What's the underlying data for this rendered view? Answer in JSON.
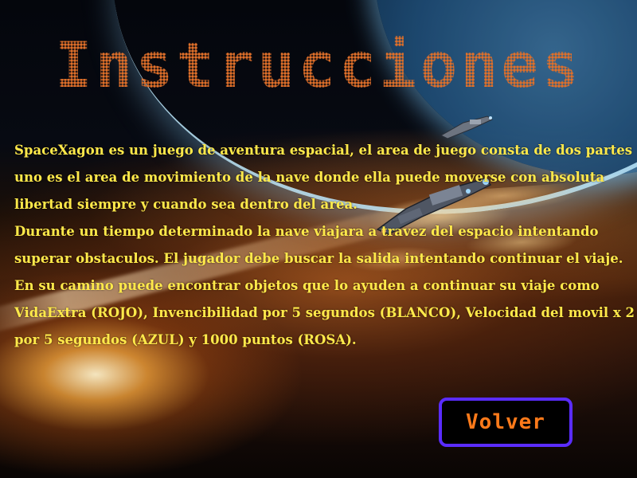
{
  "screen": {
    "title": "Instrucciones",
    "paragraphs": [
      "SpaceXagon es un juego de aventura espacial, el area de juego consta de dos partes uno es el area de movimiento de la nave donde ella puede moverse con absoluta libertad siempre y cuando sea dentro del area.",
      "Durante un tiempo determinado la nave viajara a travez del espacio intentando superar obstaculos. El jugador debe buscar la salida intentando continuar el viaje. En su camino puede encontrar objetos que lo ayuden a continuar su viaje como VidaExtra (ROJO), Invencibilidad por 5 segundos (BLANCO), Velocidad del movil x 2 por 5 segundos (AZUL) y 1000 puntos (ROSA)."
    ],
    "back_button_label": "Volver"
  },
  "colors": {
    "title": "#e0702a",
    "body_text": "#ffe94a",
    "button_border": "#5a2cff",
    "button_text": "#ff7a1a"
  },
  "icons": {
    "background": "space-scene-background",
    "ship_main": "spaceship-icon",
    "ship_small": "spaceship-small-icon"
  }
}
